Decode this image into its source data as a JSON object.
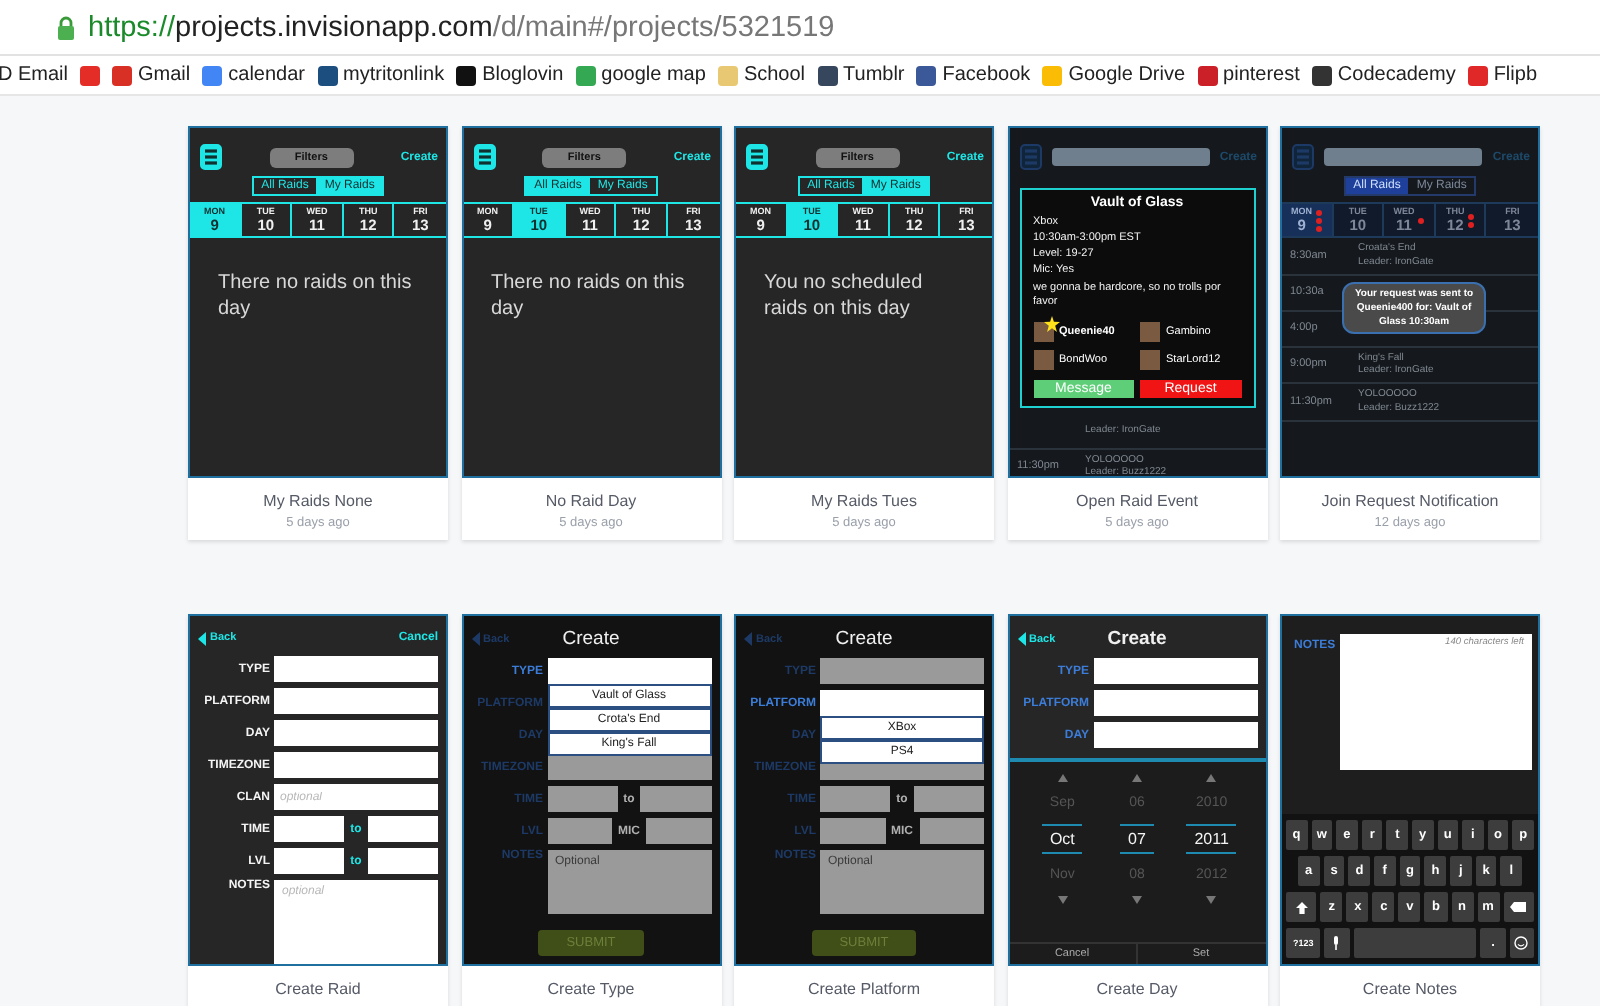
{
  "browser": {
    "url": {
      "scheme": "https://",
      "host": "projects.invisionapp.com",
      "path": "/d/main#/projects/5321519"
    }
  },
  "bookmarks": [
    {
      "label": "D Email"
    },
    {
      "color": "#e52d27"
    },
    {
      "label": "Gmail",
      "color": "#d93025"
    },
    {
      "label": "calendar",
      "color": "#4285f4"
    },
    {
      "label": "mytritonlink",
      "color": "#1c4e80"
    },
    {
      "label": "Bloglovin",
      "color": "#111111"
    },
    {
      "label": "google map",
      "color": "#34a853"
    },
    {
      "label": "School",
      "color": "#e8c872"
    },
    {
      "label": "Tumblr",
      "color": "#36465d"
    },
    {
      "label": "Facebook",
      "color": "#3b5998"
    },
    {
      "label": "Google Drive",
      "color": "#fbbc05"
    },
    {
      "label": "pinterest",
      "color": "#cb2027"
    },
    {
      "label": "Codecademy",
      "color": "#333333"
    },
    {
      "label": "Flipb",
      "color": "#e12828"
    }
  ],
  "cards": [
    {
      "title": "My Raids None",
      "time": "5 days ago",
      "screen": {
        "kind": "schedule",
        "dimmed": false,
        "header": {
          "filters": "Filters",
          "action": "Create"
        },
        "toggles": [
          {
            "label": "All Raids",
            "selected": false
          },
          {
            "label": "My Raids",
            "selected": true
          }
        ],
        "days": [
          {
            "weekday": "MON",
            "date": "9",
            "selected": true
          },
          {
            "weekday": "TUE",
            "date": "10",
            "selected": false
          },
          {
            "weekday": "WED",
            "date": "11",
            "selected": false
          },
          {
            "weekday": "THU",
            "date": "12",
            "selected": false
          },
          {
            "weekday": "FRI",
            "date": "13",
            "selected": false
          }
        ],
        "message": "There no raids on this day"
      }
    },
    {
      "title": "No Raid Day",
      "time": "5 days ago",
      "screen": {
        "kind": "schedule",
        "dimmed": false,
        "header": {
          "filters": "Filters",
          "action": "Create"
        },
        "toggles": [
          {
            "label": "All Raids",
            "selected": true
          },
          {
            "label": "My Raids",
            "selected": false
          }
        ],
        "days": [
          {
            "weekday": "MON",
            "date": "9",
            "selected": false
          },
          {
            "weekday": "TUE",
            "date": "10",
            "selected": true
          },
          {
            "weekday": "WED",
            "date": "11",
            "selected": false
          },
          {
            "weekday": "THU",
            "date": "12",
            "selected": false
          },
          {
            "weekday": "FRI",
            "date": "13",
            "selected": false
          }
        ],
        "message": "There no raids on this day"
      }
    },
    {
      "title": "My Raids Tues",
      "time": "5 days ago",
      "screen": {
        "kind": "schedule",
        "dimmed": false,
        "header": {
          "filters": "Filters",
          "action": "Create"
        },
        "toggles": [
          {
            "label": "All Raids",
            "selected": false
          },
          {
            "label": "My Raids",
            "selected": true
          }
        ],
        "days": [
          {
            "weekday": "MON",
            "date": "9",
            "selected": false
          },
          {
            "weekday": "TUE",
            "date": "10",
            "selected": true
          },
          {
            "weekday": "WED",
            "date": "11",
            "selected": false
          },
          {
            "weekday": "THU",
            "date": "12",
            "selected": false
          },
          {
            "weekday": "FRI",
            "date": "13",
            "selected": false
          }
        ],
        "message": "You no scheduled raids on this day"
      }
    },
    {
      "title": "Open Raid Event",
      "time": "5 days ago",
      "screen": {
        "kind": "schedule",
        "dimmed": true,
        "header": {
          "action": "Create"
        },
        "popup": {
          "title": "Vault of Glass",
          "lines": [
            "Xbox",
            "10:30am-3:00pm EST",
            "Level: 19-27",
            "Mic: Yes",
            "we gonna be hardcore, so no trolls por favor"
          ],
          "members": [
            {
              "name": "Queenie40",
              "leader": true
            },
            {
              "name": "Gambino",
              "leader": false
            },
            {
              "name": "BondWoo",
              "leader": false
            },
            {
              "name": "StarLord12",
              "leader": false
            }
          ],
          "buttons": [
            {
              "label": "Message",
              "color": "#5ecf78"
            },
            {
              "label": "Request",
              "color": "#f01414"
            }
          ]
        },
        "rows": [
          {
            "leader": "Leader: IronGate"
          },
          {
            "time": "11:30pm",
            "event": "YOLOOOOO",
            "leader": "Leader: Buzz1222"
          }
        ]
      }
    },
    {
      "title": "Join Request Notification",
      "time": "12 days ago",
      "screen": {
        "kind": "schedule",
        "dimmed": true,
        "header": {
          "action": "Create"
        },
        "toggles": [
          {
            "label": "All Raids",
            "selected": true
          },
          {
            "label": "My Raids",
            "selected": false
          }
        ],
        "days": [
          {
            "weekday": "MON",
            "date": "9",
            "selected": true,
            "dots": [
              {
                "color": "#e02020"
              },
              {
                "color": "#e02020"
              },
              {
                "color": "#e02020"
              }
            ]
          },
          {
            "weekday": "TUE",
            "date": "10",
            "selected": false
          },
          {
            "weekday": "WED",
            "date": "11",
            "selected": false,
            "dots": [
              {
                "color": "#e02020"
              }
            ]
          },
          {
            "weekday": "THU",
            "date": "12",
            "selected": false,
            "dots": [
              {
                "color": "#e02020"
              },
              {
                "color": "#e02020"
              }
            ]
          },
          {
            "weekday": "FRI",
            "date": "13",
            "selected": false
          }
        ],
        "rows": [
          {
            "time": "8:30am",
            "event": "Croata's End",
            "leader": "Leader: IronGate"
          },
          {
            "time": "10:30a"
          },
          {
            "time": "4:00p"
          },
          {
            "time": "9:00pm",
            "event": "King's Fall",
            "leader": "Leader: IronGate"
          },
          {
            "time": "11:30pm",
            "event": "YOLOOOOO",
            "leader": "Leader: Buzz1222"
          }
        ],
        "toast": "Your request was sent to Queenie400 for: Vault of Glass 10:30am"
      }
    },
    {
      "title": "Create Raid",
      "screen": {
        "kind": "form",
        "dimmed": false,
        "header": {
          "back": "Back",
          "action": "Cancel"
        },
        "fields": [
          {
            "label": "TYPE",
            "kind": "text",
            "highlighted": false
          },
          {
            "label": "PLATFORM",
            "kind": "text",
            "highlighted": false
          },
          {
            "label": "DAY",
            "kind": "text",
            "highlighted": false
          },
          {
            "label": "TIMEZONE",
            "kind": "text",
            "highlighted": false
          },
          {
            "label": "CLAN",
            "kind": "text",
            "placeholder": "optional",
            "highlighted": false
          },
          {
            "label": "TIME",
            "kind": "range",
            "joiner": "to",
            "highlighted": false
          },
          {
            "label": "LVL",
            "kind": "range",
            "joiner": "to",
            "highlighted": false
          },
          {
            "label": "NOTES",
            "kind": "area",
            "placeholder": "optional",
            "highlighted": false
          }
        ]
      }
    },
    {
      "title": "Create Type",
      "screen": {
        "kind": "form",
        "dimmed": true,
        "header": {
          "back": "Back",
          "title": "Create"
        },
        "fields": [
          {
            "label": "TYPE",
            "kind": "text",
            "highlighted": true,
            "options": [
              "Vault of Glass",
              "Crota's End",
              "King's Fall"
            ]
          },
          {
            "label": "PLATFORM",
            "kind": "text",
            "highlighted": false
          },
          {
            "label": "DAY",
            "kind": "text",
            "highlighted": false
          },
          {
            "label": "TIMEZONE",
            "kind": "text",
            "highlighted": false
          },
          {
            "label": "TIME",
            "kind": "range",
            "joiner": "to",
            "highlighted": false
          },
          {
            "label": "LVL",
            "kind": "range",
            "joiner": "MIC",
            "highlighted": false
          },
          {
            "label": "NOTES",
            "kind": "area",
            "placeholder": "Optional",
            "highlighted": false
          }
        ],
        "submit": "SUBMIT"
      }
    },
    {
      "title": "Create Platform",
      "screen": {
        "kind": "form",
        "dimmed": true,
        "header": {
          "back": "Back",
          "title": "Create"
        },
        "fields": [
          {
            "label": "TYPE",
            "kind": "text",
            "highlighted": false
          },
          {
            "label": "PLATFORM",
            "kind": "text",
            "highlighted": true,
            "options": [
              "XBox",
              "PS4"
            ]
          },
          {
            "label": "DAY",
            "kind": "text",
            "highlighted": false
          },
          {
            "label": "TIMEZONE",
            "kind": "text",
            "highlighted": false
          },
          {
            "label": "TIME",
            "kind": "range",
            "joiner": "to",
            "highlighted": false
          },
          {
            "label": "LVL",
            "kind": "range",
            "joiner": "MIC",
            "highlighted": false
          },
          {
            "label": "NOTES",
            "kind": "area",
            "placeholder": "Optional",
            "highlighted": false
          }
        ],
        "submit": "SUBMIT"
      }
    },
    {
      "title": "Create Day",
      "screen": {
        "kind": "form",
        "dimmed": false,
        "header": {
          "back": "Back",
          "title": "Create"
        },
        "fields": [
          {
            "label": "TYPE",
            "kind": "text",
            "highlighted": true
          },
          {
            "label": "PLATFORM",
            "kind": "text",
            "highlighted": true
          },
          {
            "label": "DAY",
            "kind": "text",
            "highlighted": true
          }
        ],
        "picker": {
          "columns": [
            [
              {
                "value": "Sep",
                "selected": false
              },
              {
                "value": "Oct",
                "selected": true
              },
              {
                "value": "Nov",
                "selected": false
              }
            ],
            [
              {
                "value": "06",
                "selected": false
              },
              {
                "value": "07",
                "selected": true
              },
              {
                "value": "08",
                "selected": false
              }
            ],
            [
              {
                "value": "2010",
                "selected": false
              },
              {
                "value": "2011",
                "selected": true
              },
              {
                "value": "2012",
                "selected": false
              }
            ]
          ],
          "buttons": [
            "Cancel",
            "Set"
          ]
        }
      }
    },
    {
      "title": "Create Notes",
      "screen": {
        "kind": "notes",
        "label": "NOTES",
        "counter": "140 characters left",
        "keyboard": {
          "rows": [
            [
              "q",
              "w",
              "e",
              "r",
              "t",
              "y",
              "u",
              "i",
              "o",
              "p"
            ],
            [
              "a",
              "s",
              "d",
              "f",
              "g",
              "h",
              "j",
              "k",
              "l"
            ],
            [
              "z",
              "x",
              "c",
              "v",
              "b",
              "n",
              "m"
            ]
          ],
          "symbols": "?123",
          "period": "."
        }
      }
    }
  ]
}
